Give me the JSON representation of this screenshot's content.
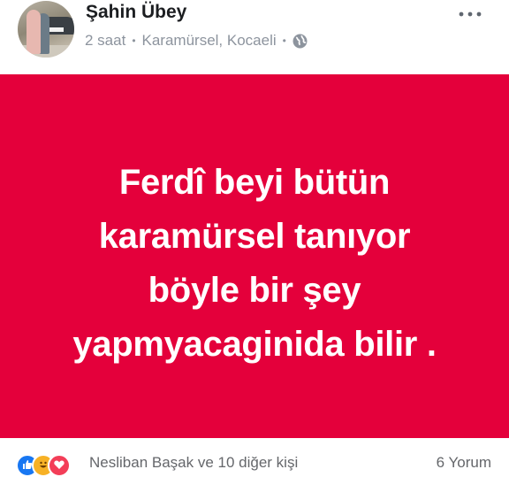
{
  "post": {
    "author": "Şahin Übey",
    "time": "2 saat",
    "separator": "•",
    "location": "Karamürsel, Kocaeli",
    "image_text_lines": [
      "Ferdî beyi bütün",
      "karamürsel tanıyor",
      "böyle bir şey",
      "yapmyacaginida bilir ."
    ],
    "background_color": "#e4003b"
  },
  "footer": {
    "reactors": "Nesliban Başak ve 10 diğer kişi",
    "comments": "6 Yorum",
    "reaction_icons": [
      "like-icon",
      "haha-icon",
      "love-icon"
    ]
  },
  "icons": {
    "privacy": "globe-icon",
    "options": "more-options-icon"
  }
}
